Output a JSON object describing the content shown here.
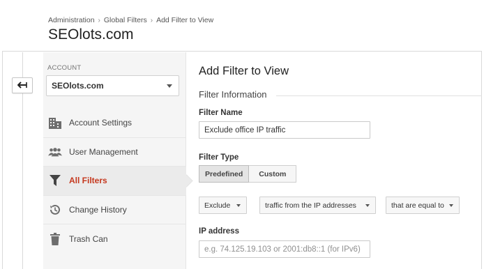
{
  "breadcrumb": [
    "Administration",
    "Global Filters",
    "Add Filter to View"
  ],
  "breadcrumb_separator": "›",
  "site_title": "SEOlots.com",
  "sidebar": {
    "account_label": "ACCOUNT",
    "account_value": "SEOlots.com",
    "items": [
      {
        "label": "Account Settings",
        "icon": "building-icon"
      },
      {
        "label": "User Management",
        "icon": "users-icon"
      },
      {
        "label": "All Filters",
        "icon": "filter-icon",
        "active": true
      },
      {
        "label": "Change History",
        "icon": "history-icon"
      },
      {
        "label": "Trash Can",
        "icon": "trash-icon"
      }
    ]
  },
  "main": {
    "page_title": "Add Filter to View",
    "section_title": "Filter Information",
    "filter_name_label": "Filter Name",
    "filter_name_value": "Exclude office IP traffic",
    "filter_type_label": "Filter Type",
    "filter_type_options": [
      "Predefined",
      "Custom"
    ],
    "filter_type_selected": "Predefined",
    "dropdowns": {
      "action": "Exclude",
      "source": "traffic from the IP addresses",
      "match": "that are equal to"
    },
    "ip_label": "IP address",
    "ip_placeholder": "e.g. 74.125.19.103 or 2001:db8::1 (for IPv6)"
  },
  "colors": {
    "active_accent": "#c5381e",
    "sidebar_bg": "#f5f5f5",
    "border": "#d9d9d9"
  }
}
